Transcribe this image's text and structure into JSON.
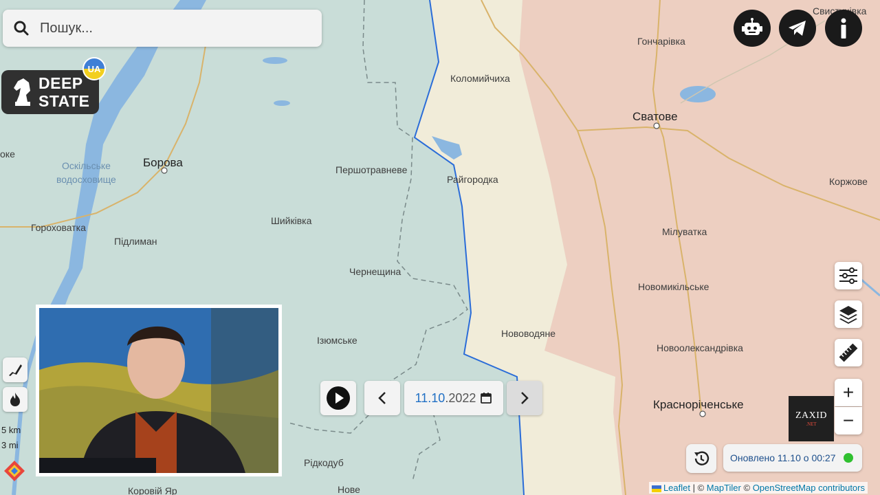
{
  "search": {
    "placeholder": "Пошук..."
  },
  "logo": {
    "line1": "DEEP",
    "line2": "STATE",
    "badge": "UA"
  },
  "top_buttons": [
    {
      "name": "bot-icon"
    },
    {
      "name": "telegram-icon"
    },
    {
      "name": "info-icon"
    }
  ],
  "map_labels": {
    "svystunivka": "Свистунівка",
    "honcharivka": "Гончарівка",
    "kolomyichykha": "Коломийчиха",
    "svatove": "Сватове",
    "borova": "Борова",
    "oskil_res_1": "Оскільське",
    "oskil_res_2": "водосховище",
    "pershotravneve": "Першотравневе",
    "raihorodka": "Райгородка",
    "korzhove": "Коржове",
    "horokhovatka": "Гороховатка",
    "pidlyman": "Підлиман",
    "shyikivka": "Шийківка",
    "miluvatka": "Мілуватка",
    "chernechshyna": "Чернещина",
    "novomykilske": "Новомикільське",
    "novovodiane": "Нововодяне",
    "iziumske": "Ізюмське",
    "novooleksandrivka": "Новоолександрівка",
    "krasnorichenske": "Красноріченське",
    "ridkodub": "Рідкодуб",
    "nove": "Нове",
    "korovii_yar": "Коровій Яр",
    "oke_fragment": "оке"
  },
  "timeline": {
    "day": "11.10",
    "year": ".2022"
  },
  "scale": {
    "km": "5 km",
    "mi": "3 mi"
  },
  "status": {
    "updated": "Оновлено 11.10 о 00:27",
    "indicator_color": "#30c030"
  },
  "zoom": {
    "in": "+",
    "out": "−"
  },
  "watermark": {
    "line1": "ZAXID",
    "line2": ".NET"
  },
  "attribution": {
    "leaflet": "Leaflet",
    "sep": " | © ",
    "maptiler": "MapTiler",
    "sep2": " © ",
    "osm": "OpenStreetMap contributors"
  },
  "colors": {
    "ukraine_control": "#c8ddd9",
    "liberated": "#f1ecd9",
    "occupied": "#eed1c3",
    "front_line": "#2a6cd8"
  }
}
